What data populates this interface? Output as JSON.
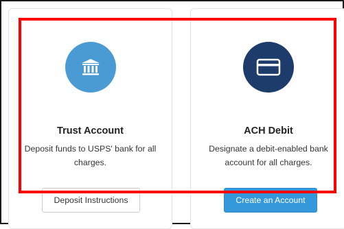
{
  "cards": {
    "trust": {
      "title": "Trust Account",
      "description": "Deposit funds to USPS' bank for all charges.",
      "button_label": "Deposit Instructions",
      "icon": "bank-icon",
      "circle_color": "#4a9bd4"
    },
    "ach": {
      "title": "ACH Debit",
      "description": "Designate a debit-enabled bank account for all charges.",
      "button_label": "Create an Account",
      "icon": "credit-card-icon",
      "circle_color": "#1d3b6b"
    }
  },
  "colors": {
    "primary_button": "#3498db",
    "highlight": "#ff0000",
    "frame": "#1a1a1a"
  }
}
